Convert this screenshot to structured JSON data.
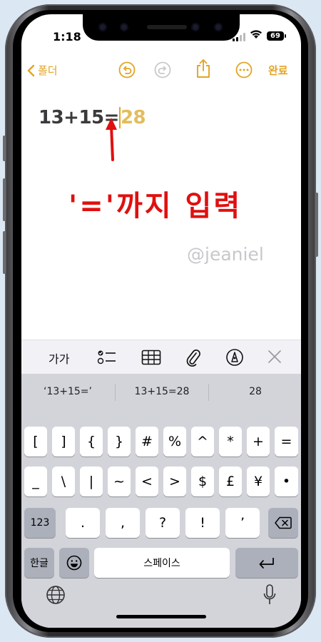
{
  "status": {
    "time": "1:18",
    "battery": "69"
  },
  "nav": {
    "back_label": "폴더",
    "done_label": "완료"
  },
  "note": {
    "typed": "13+15=",
    "suggested": "28"
  },
  "annotation": {
    "text": "'='까지 입력"
  },
  "watermark": "@jeaniel",
  "toolbar": {
    "format_label": "가가"
  },
  "predictions": [
    "‘13+15=’",
    "13+15=28",
    "28"
  ],
  "keyboard": {
    "row1": [
      "[",
      "]",
      "{",
      "}",
      "#",
      "%",
      "^",
      "*",
      "+",
      "="
    ],
    "row2": [
      "_",
      "\\",
      "|",
      "~",
      "<",
      ">",
      "$",
      "£",
      "¥",
      "•"
    ],
    "row3": {
      "mode": "123",
      "keys": [
        ".",
        ",",
        "?",
        "!",
        "’"
      ]
    },
    "lang_label": "한글",
    "space_label": "스페이스"
  },
  "icons": [
    "chevron-left-icon",
    "undo-icon",
    "redo-icon",
    "share-icon",
    "more-icon",
    "checklist-icon",
    "table-icon",
    "paperclip-icon",
    "markup-icon",
    "close-icon",
    "delete-icon",
    "emoji-icon",
    "return-icon",
    "globe-icon",
    "mic-icon"
  ],
  "colors": {
    "accent": "#e3a424",
    "annotation": "#e01010",
    "suggestion": "#e3bd5a"
  }
}
